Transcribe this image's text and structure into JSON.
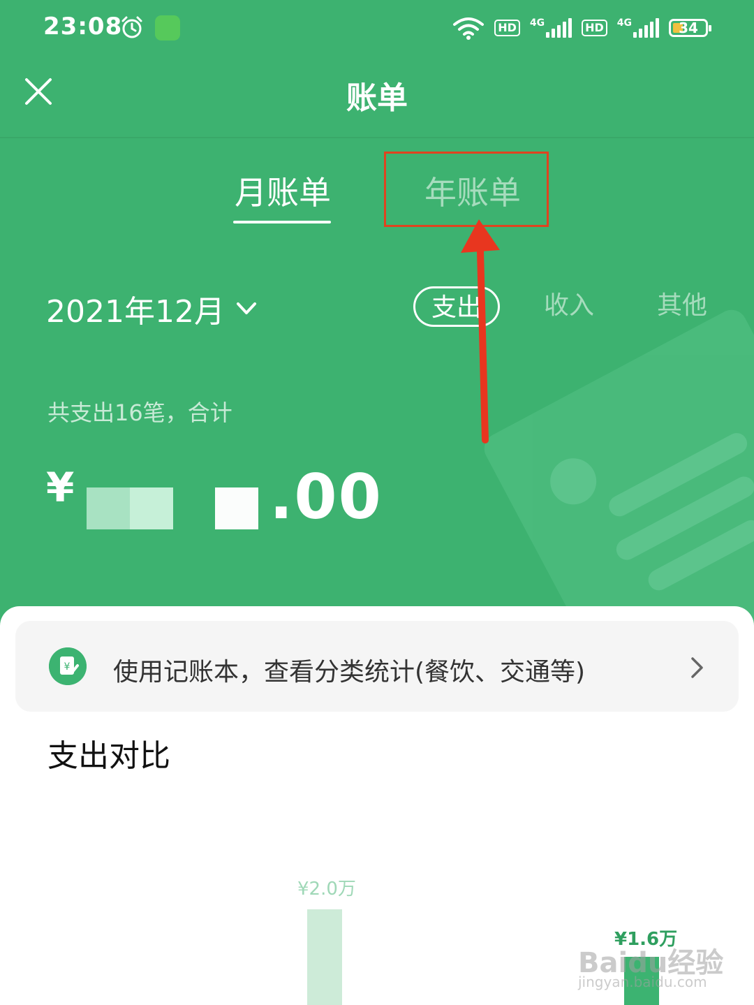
{
  "status_bar": {
    "time": "23:08",
    "hd1": "HD",
    "sig1": "4G",
    "hd2": "HD",
    "sig2": "4G",
    "battery": "34",
    "icons": [
      "alarm-icon",
      "app-notification-icon",
      "wifi-icon",
      "signal-icon",
      "battery-icon"
    ]
  },
  "header": {
    "title": "账单",
    "close_icon": "close-icon"
  },
  "tabs": [
    {
      "label": "月账单",
      "active": true
    },
    {
      "label": "年账单",
      "active": false
    }
  ],
  "filters": {
    "date": "2021年12月",
    "segments": [
      {
        "label": "支出",
        "active": true
      },
      {
        "label": "收入",
        "active": false
      },
      {
        "label": "其他",
        "active": false
      }
    ]
  },
  "summary": {
    "text": "共支出16笔，合计",
    "currency": "¥",
    "amount_visible": ".00"
  },
  "promo": {
    "text": "使用记账本，查看分类统计(餐饮、交通等)"
  },
  "comparison": {
    "title": "支出对比"
  },
  "chart_data": {
    "type": "bar",
    "values": [
      2.0,
      1.6
    ],
    "value_labels": [
      "¥2.0万",
      "¥1.6万"
    ],
    "unit": "万"
  },
  "watermark": {
    "text": "Baidu经验",
    "sub": "jingyan.baidu.com"
  },
  "colors": {
    "brand_green": "#3db270",
    "annotation_red": "#e0431f",
    "bar_light": "#cdebd8",
    "bar_dark": "#3cb371"
  }
}
